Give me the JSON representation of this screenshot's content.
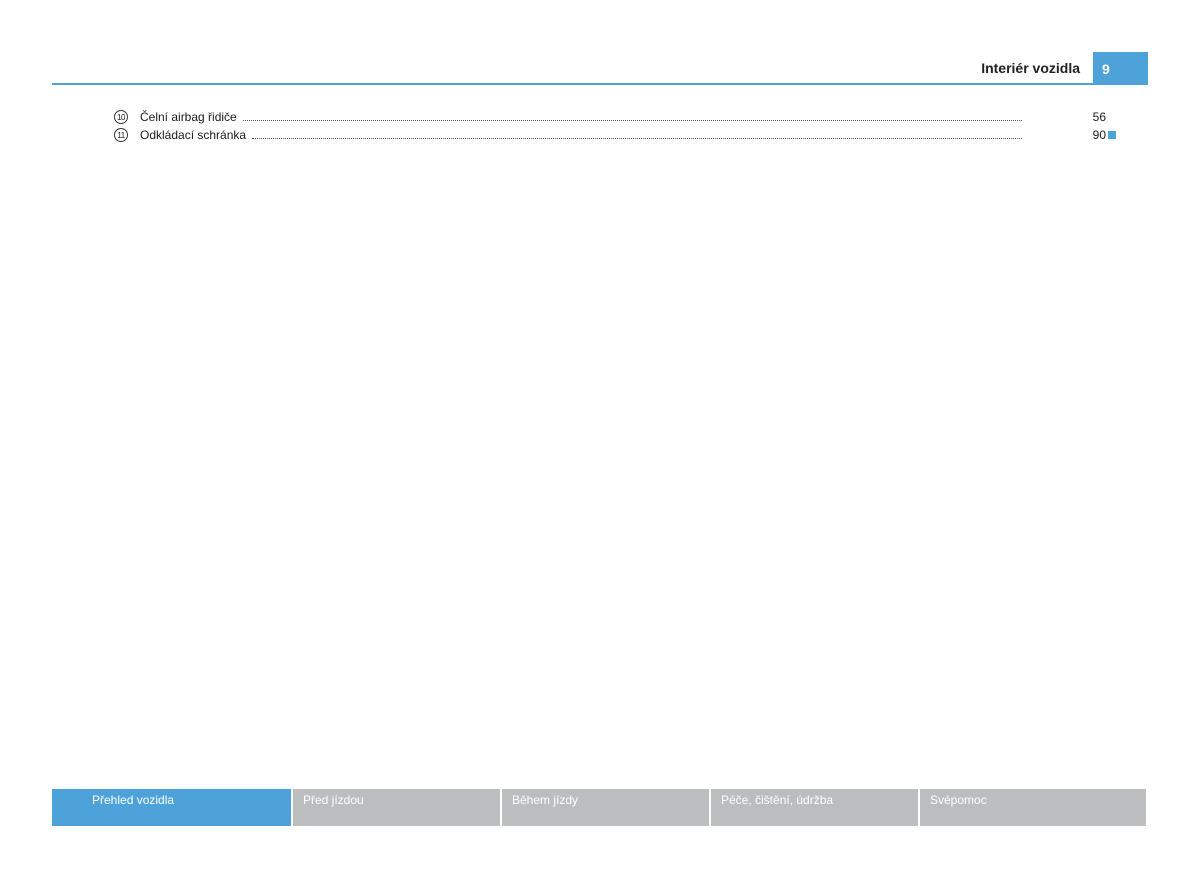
{
  "header": {
    "chapter_title": "Interiér vozidla",
    "page_number": "9"
  },
  "toc": {
    "items": [
      {
        "number": "10",
        "label": "Čelní airbag řidiče",
        "page": "56",
        "end_mark": false
      },
      {
        "number": "11",
        "label": "Odkládací schránka",
        "page": "90",
        "end_mark": true
      }
    ]
  },
  "footer": {
    "tabs": [
      {
        "label": "Přehled vozidla",
        "active": true
      },
      {
        "label": "Před jízdou",
        "active": false
      },
      {
        "label": "Během jízdy",
        "active": false
      },
      {
        "label": "Péče, čištění, údržba",
        "active": false
      },
      {
        "label": "Svépomoc",
        "active": false
      }
    ]
  },
  "colors": {
    "accent": "#4da3d9",
    "inactive_tab": "#bcbdbf"
  }
}
